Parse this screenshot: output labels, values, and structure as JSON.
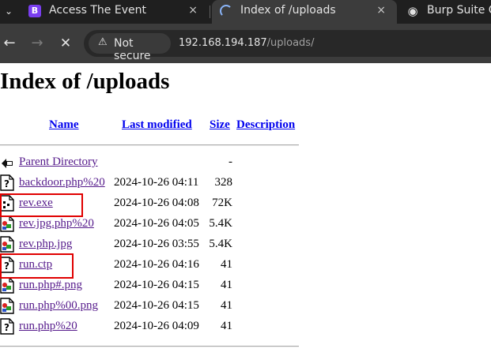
{
  "tabs": [
    {
      "title": "Access The Event",
      "favicon": "bootstrap-icon",
      "close": "×"
    },
    {
      "title": "Index of /uploads",
      "favicon": "loading-spinner-icon",
      "close": "×"
    },
    {
      "title": "Burp Suite Co",
      "favicon": "globe-icon"
    }
  ],
  "tab_menu_glyph": "⌄",
  "toolbar": {
    "back_glyph": "←",
    "forward_glyph": "→",
    "stop_glyph": "✕",
    "security_label": "Not secure",
    "warning_glyph": "⚠",
    "url_host": "192.168.194.187",
    "url_path": "/uploads/"
  },
  "page": {
    "heading": "Index of /uploads",
    "columns": {
      "name": "Name",
      "modified": "Last modified",
      "size": "Size",
      "description": "Description"
    },
    "rows": [
      {
        "name": "Parent Directory",
        "date": "",
        "size": "-",
        "icon": "parent-directory-icon"
      },
      {
        "name": "backdoor.php%20",
        "date": "2024-10-26 04:11",
        "size": "328",
        "icon": "unknown-file-icon"
      },
      {
        "name": "rev.exe",
        "date": "2024-10-26 04:08",
        "size": "72K",
        "icon": "binary-file-icon"
      },
      {
        "name": "rev.jpg.php%20",
        "date": "2024-10-26 04:05",
        "size": "5.4K",
        "icon": "image-file-icon"
      },
      {
        "name": "rev.php.jpg",
        "date": "2024-10-26 03:55",
        "size": "5.4K",
        "icon": "image-file-icon"
      },
      {
        "name": "run.ctp",
        "date": "2024-10-26 04:16",
        "size": "41",
        "icon": "unknown-file-icon"
      },
      {
        "name": "run.php#.png",
        "date": "2024-10-26 04:15",
        "size": "41",
        "icon": "image-file-icon"
      },
      {
        "name": "run.php%00.png",
        "date": "2024-10-26 04:15",
        "size": "41",
        "icon": "image-file-icon"
      },
      {
        "name": "run.php%20",
        "date": "2024-10-26 04:09",
        "size": "41",
        "icon": "unknown-file-icon"
      }
    ],
    "highlight_color": "#e00000"
  }
}
